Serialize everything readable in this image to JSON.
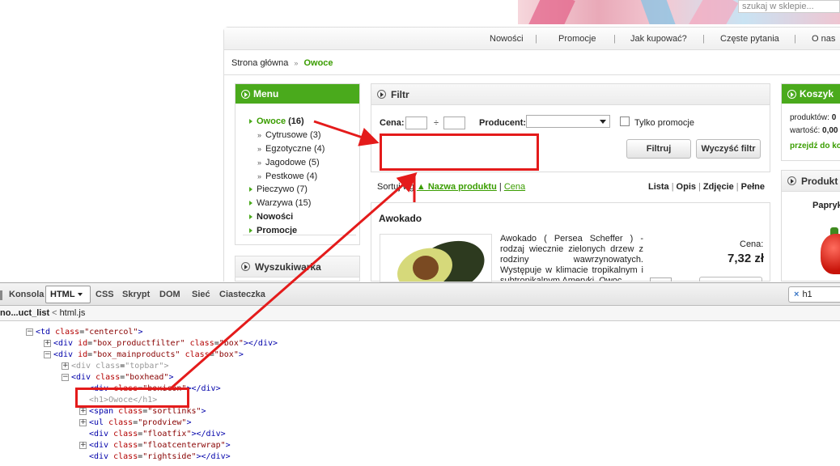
{
  "banner": {
    "search_placeholder": "szukaj w sklepie..."
  },
  "topnav": {
    "items": [
      "Nowości",
      "Promocje",
      "Jak kupować?",
      "Częste pytania",
      "O nas"
    ]
  },
  "breadcrumb": {
    "home": "Strona główna",
    "arrow": "»",
    "current": "Owoce"
  },
  "menu": {
    "title": "Menu",
    "items": [
      {
        "label": "Owoce",
        "count": "(16)"
      },
      {
        "label": "Cytrusowe",
        "count": "(3)"
      },
      {
        "label": "Egzotyczne",
        "count": "(4)"
      },
      {
        "label": "Jagodowe",
        "count": "(5)"
      },
      {
        "label": "Pestkowe",
        "count": "(4)"
      },
      {
        "label": "Pieczywo",
        "count": "(7)"
      },
      {
        "label": "Warzywa",
        "count": "(15)"
      },
      {
        "label": "Nowości",
        "count": ""
      },
      {
        "label": "Promocje",
        "count": ""
      }
    ]
  },
  "search_box": {
    "title": "Wyszukiwarka"
  },
  "filter": {
    "title": "Filtr",
    "price_label": "Cena:",
    "price_separator": "÷",
    "producer_label": "Producent:",
    "promo_only_label": "Tylko promocje",
    "filter_button": "Filtruj",
    "clear_button": "Wyczyść filtr"
  },
  "sort": {
    "prefix": "Sortuj wg",
    "by_name": "▲ Nazwa produktu",
    "separator": "|",
    "by_price": "Cena"
  },
  "views": {
    "list": "Lista",
    "desc": "Opis",
    "photo": "Zdjęcie",
    "full": "Pełne",
    "sep": "|"
  },
  "product": {
    "name": "Awokado",
    "description": "Awokado ( Persea Scheffer ) - rodzaj wiecznie zielonych drzew z rodziny wawrzynowatych. Występuje w klimacie tropikalnym i subtropikalnym Ameryki. Owoc",
    "price_label": "Cena:",
    "price": "7,32 zł"
  },
  "cart": {
    "title": "Koszyk",
    "products_label": "produktów:",
    "products_value": "0",
    "value_label": "wartość:",
    "value_value": "0,00",
    "link": "przejdź do ko"
  },
  "side_products": {
    "title": "Produkt",
    "item": "Papryk"
  },
  "devtools": {
    "tabs": {
      "console": "Konsola",
      "html": "HTML",
      "css": "CSS",
      "script": "Skrypt",
      "dom": "DOM",
      "net": "Sieć",
      "cookies": "Ciasteczka"
    },
    "search_value": "h1",
    "search_clear": "×",
    "breadcrumb": {
      "first": "no...uct_list",
      "sep": "<",
      "second": "html.js"
    }
  },
  "tree": {
    "n1_tag": "<td",
    "n1_attr": "class",
    "n1_val": "\"centercol\"",
    "n1_end": ">",
    "n2_tag": "<div",
    "n2_a1": "id",
    "n2_v1": "\"box_productfilter\"",
    "n2_a2": "class",
    "n2_v2": "\"box\"",
    "n2_end": "></div>",
    "n3_tag": "<div",
    "n3_a1": "id",
    "n3_v1": "\"box_mainproducts\"",
    "n3_a2": "class",
    "n3_v2": "\"box\"",
    "n3_end": ">",
    "n4_tag": "<div",
    "n4_attr": "class",
    "n4_val": "\"topbar\"",
    "n4_end": ">",
    "n5_tag": "<div",
    "n5_attr": "class",
    "n5_val": "\"boxhead\"",
    "n5_end": ">",
    "n6_tag": "<div",
    "n6_attr": "class",
    "n6_val": "\"boxicon\"",
    "n6_end": "></div>",
    "n7_tag": "<h1>",
    "n7_text": "Owoce",
    "n7_close": "</h1>",
    "n8_tag": "<span",
    "n8_attr": "class",
    "n8_val": "\"sortlinks\"",
    "n8_end": ">",
    "n9_tag": "<ul",
    "n9_attr": "class",
    "n9_val": "\"prodview\"",
    "n9_end": ">",
    "n10_tag": "<div",
    "n10_attr": "class",
    "n10_val": "\"floatfix\"",
    "n10_end": "></div>",
    "n11_tag": "<div",
    "n11_attr": "class",
    "n11_val": "\"floatcenterwrap\"",
    "n11_end": ">",
    "n12_tag": "<div",
    "n12_attr": "class",
    "n12_val": "\"rightside\"",
    "n12_end": "></div>",
    "expand": "+",
    "collapse": "−"
  },
  "colors": {
    "accent_green": "#4aaa1c",
    "annotation_red": "#e41b1b",
    "tag_blue": "#0000aa"
  }
}
